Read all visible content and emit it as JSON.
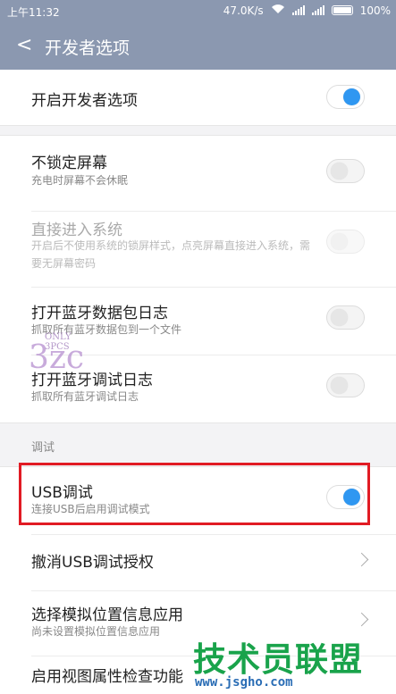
{
  "status_bar": {
    "time": "上午11:32",
    "net_speed": "47.0K/s",
    "battery": "100%"
  },
  "header": {
    "title": "开发者选项"
  },
  "items": [
    {
      "label": "开启开发者选项",
      "toggle": "on"
    },
    {
      "label": "不锁定屏幕",
      "sub": "充电时屏幕不会休眠",
      "toggle": "off"
    },
    {
      "label": "直接进入系统",
      "sub": "开启后不使用系统的锁屏样式，点亮屏幕直接进入系统，需要无屏幕密码",
      "toggle": "off",
      "disabled": true
    },
    {
      "label": "打开蓝牙数据包日志",
      "sub": "抓取所有蓝牙数据包到一个文件",
      "toggle": "off"
    },
    {
      "label": "打开蓝牙调试日志",
      "sub": "抓取所有蓝牙调试日志",
      "toggle": "off"
    },
    {
      "label": "USB调试",
      "sub": "连接USB后启用调试模式",
      "toggle": "on"
    },
    {
      "label": "撤消USB调试授权"
    },
    {
      "label": "选择模拟位置信息应用",
      "sub": "尚未设置模拟位置信息应用"
    },
    {
      "label": "启用视图属性检查功能"
    }
  ],
  "section": {
    "debug_header": "调试"
  },
  "watermark": {
    "main": "3zc",
    "tag": "ONLY 3PCS"
  },
  "brand": {
    "text": "技术员联盟",
    "url": "www.jsgho.com"
  },
  "colors": {
    "accent": "#2f97f1",
    "header_bg": "#8b98b0",
    "highlight": "#e11b24"
  }
}
